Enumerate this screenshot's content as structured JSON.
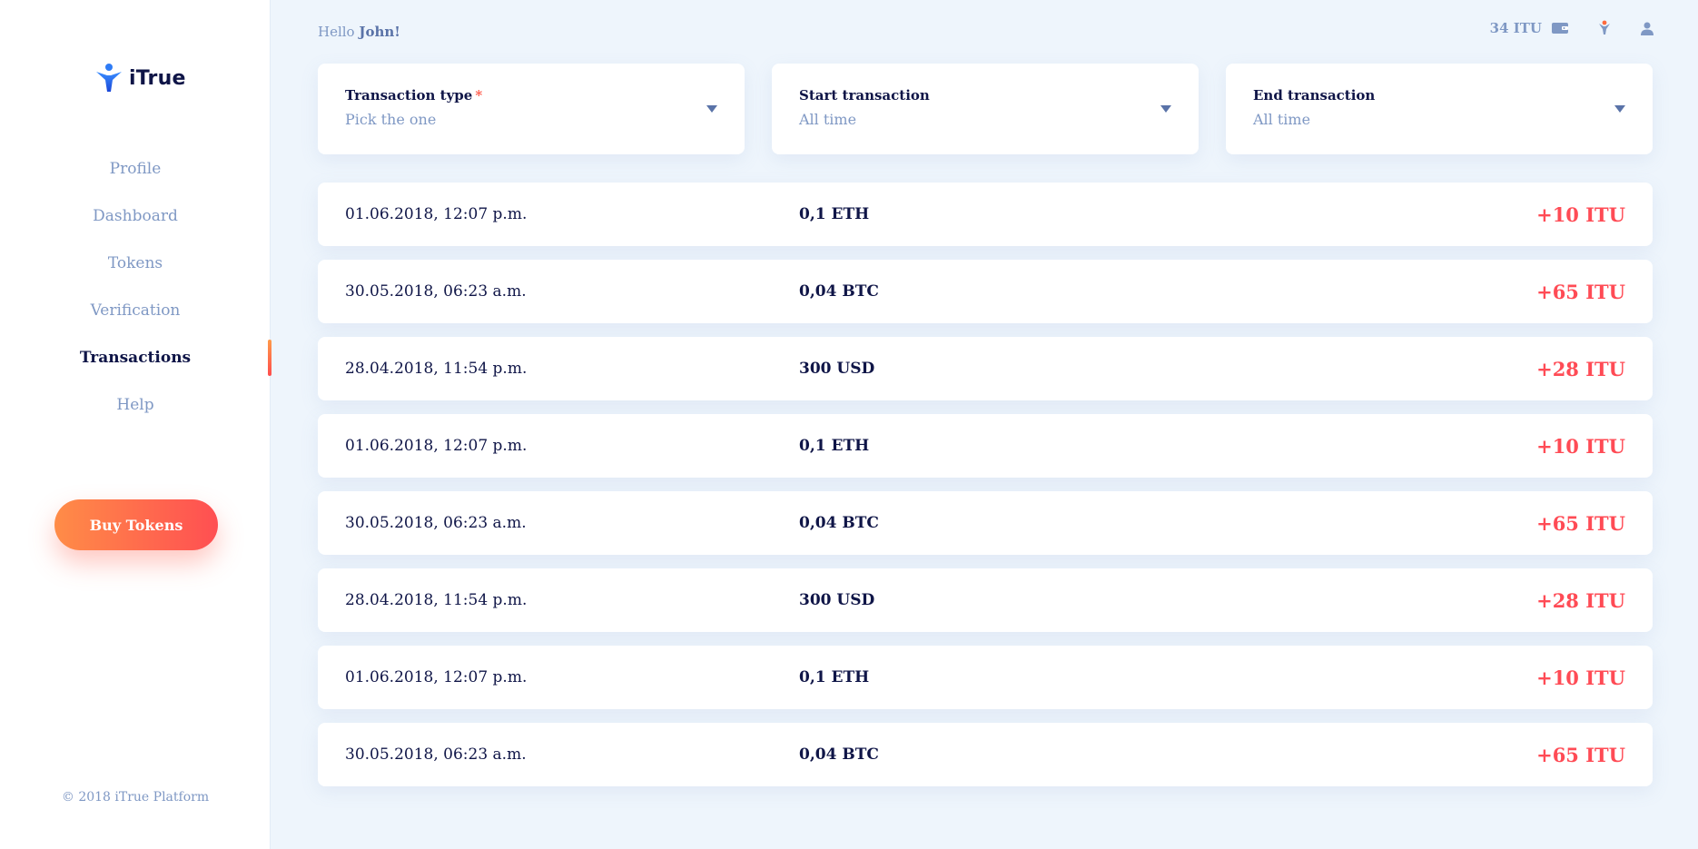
{
  "brand": {
    "name": "iTrue"
  },
  "sidebar": {
    "items": [
      {
        "label": "Profile"
      },
      {
        "label": "Dashboard"
      },
      {
        "label": "Tokens"
      },
      {
        "label": "Verification"
      },
      {
        "label": "Transactions",
        "active": true
      },
      {
        "label": "Help"
      }
    ],
    "buy_label": "Buy Tokens",
    "copyright": "© 2018 iTrue Platform"
  },
  "header": {
    "greeting_prefix": "Hello",
    "user_name": "John!",
    "balance": "34 ITU",
    "icons": [
      "wallet-icon",
      "notifications-icon",
      "user-icon"
    ]
  },
  "filters": [
    {
      "label": "Transaction type",
      "required": true,
      "value": "Pick the one"
    },
    {
      "label": "Start transaction",
      "value": "All time"
    },
    {
      "label": "End transaction",
      "value": "All time"
    }
  ],
  "transactions": [
    {
      "date": "01.06.2018, 12:07 p.m.",
      "amount": "0,1 ETH",
      "tokens": "+10 ITU"
    },
    {
      "date": "30.05.2018, 06:23 a.m.",
      "amount": "0,04 BTC",
      "tokens": "+65 ITU"
    },
    {
      "date": "28.04.2018, 11:54 p.m.",
      "amount": "300 USD",
      "tokens": "+28 ITU"
    },
    {
      "date": "01.06.2018, 12:07 p.m.",
      "amount": "0,1 ETH",
      "tokens": "+10 ITU"
    },
    {
      "date": "30.05.2018, 06:23 a.m.",
      "amount": "0,04 BTC",
      "tokens": "+65 ITU"
    },
    {
      "date": "28.04.2018, 11:54 p.m.",
      "amount": "300 USD",
      "tokens": "+28 ITU"
    },
    {
      "date": "01.06.2018, 12:07 p.m.",
      "amount": "0,1 ETH",
      "tokens": "+10 ITU"
    },
    {
      "date": "30.05.2018, 06:23 a.m.",
      "amount": "0,04 BTC",
      "tokens": "+65 ITU"
    }
  ],
  "colors": {
    "accent": "#ff4b55",
    "accent_gradient_start": "#ff8c47",
    "muted": "#7f98c4",
    "text": "#0f1547",
    "background": "#eef5fc"
  }
}
